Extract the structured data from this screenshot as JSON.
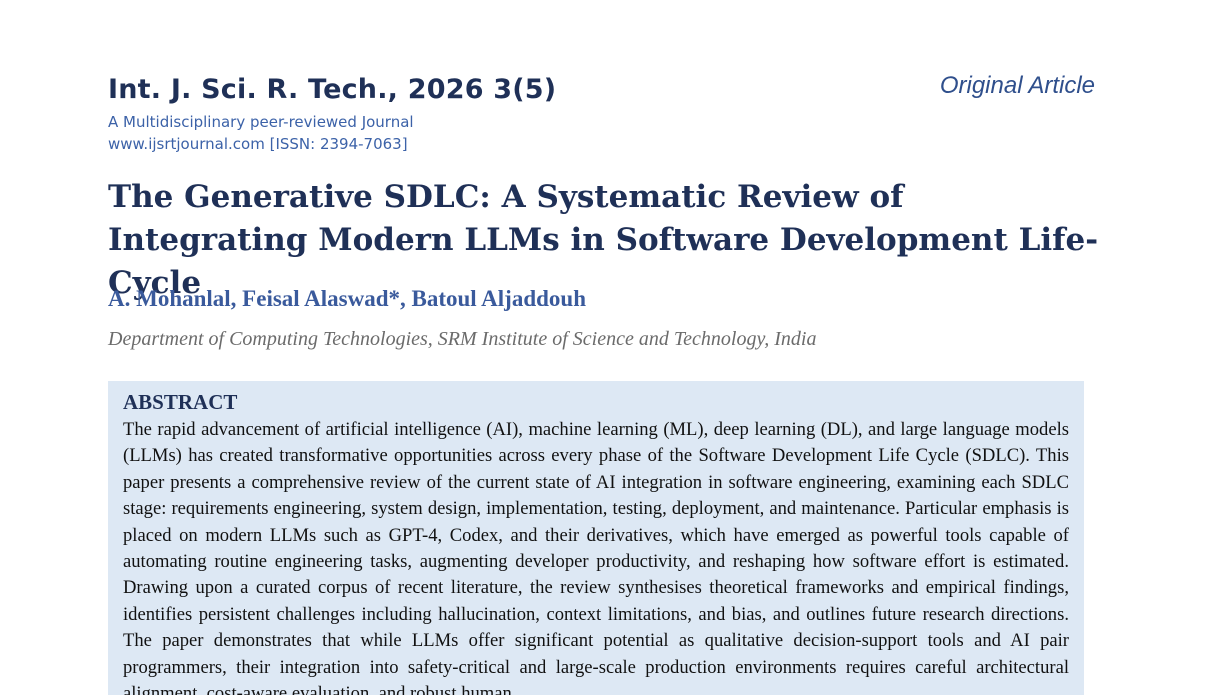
{
  "journal": {
    "title": "Int. J. Sci. R. Tech., 2026 3(5)",
    "tagline": "A Multidisciplinary peer-reviewed Journal",
    "website_issn": "www.ijsrtjournal.com [ISSN: 2394-7063]"
  },
  "article_type": "Original Article",
  "paper": {
    "title": "The Generative SDLC: A Systematic Review of Integrating Modern LLMs in Software Development Life-Cycle",
    "authors": "A. Mohanlal, Feisal Alaswad*, Batoul Aljaddouh",
    "affiliation": "Department of Computing Technologies, SRM Institute of Science and Technology, India"
  },
  "abstract": {
    "heading": "ABSTRACT",
    "text": "The rapid advancement of artificial intelligence (AI), machine learning (ML), deep learning (DL), and large language models (LLMs) has created transformative opportunities across every phase of the Software Development Life Cycle (SDLC). This paper presents a comprehensive review of the current state of AI integration in software engineering, examining each SDLC stage: requirements engineering, system design, implementation, testing, deployment, and maintenance. Particular emphasis is placed on modern LLMs such as GPT-4, Codex, and their derivatives, which have emerged as powerful tools capable of automating routine engineering tasks, augmenting developer productivity, and reshaping how software effort is estimated. Drawing upon a curated corpus of recent literature, the review synthesises theoretical frameworks and empirical findings, identifies persistent challenges including hallucination, context limitations, and bias, and outlines future research directions. The paper demonstrates that while LLMs offer significant potential as qualitative decision-support tools and AI pair programmers, their integration into safety-critical and large-scale production environments requires careful architectural alignment, cost-aware evaluation, and robust human"
  }
}
